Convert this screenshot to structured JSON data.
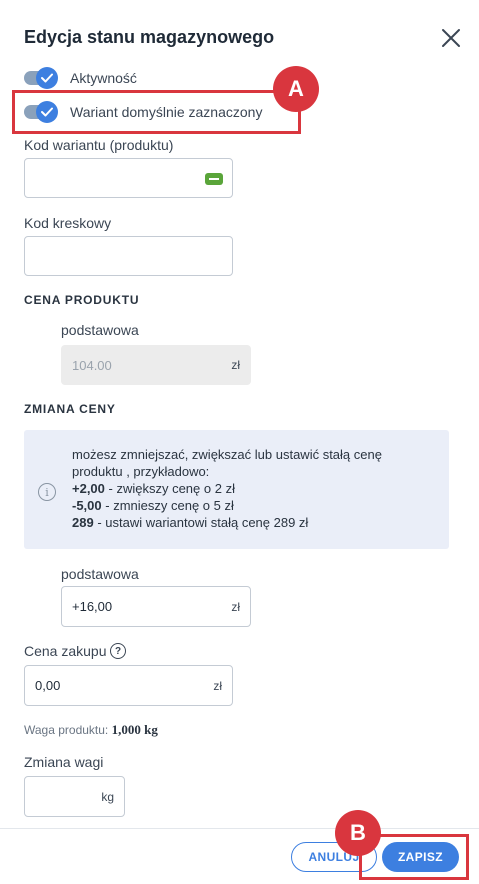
{
  "dialog": {
    "title": "Edycja stanu magazynowego"
  },
  "toggles": {
    "active_label": "Aktywność",
    "default_variant_label": "Wariant domyślnie zaznaczony"
  },
  "fields": {
    "variant_code_label": "Kod wariantu (produktu)",
    "variant_code_value": "",
    "barcode_label": "Kod kreskowy",
    "barcode_value": ""
  },
  "price_section": {
    "heading": "CENA PRODUKTU",
    "base_label": "podstawowa",
    "base_value": "104.00",
    "currency": "zł"
  },
  "price_change": {
    "heading": "ZMIANA CENY",
    "info_intro": "możesz zmniejszać, zwiększać lub ustawić stałą cenę produktu , przykładowo:",
    "ex1_bold": "+2,00",
    "ex1_text": " - zwiększy cenę o 2 zł",
    "ex2_bold": "-5,00",
    "ex2_text": " - zmnieszy cenę o 5 zł",
    "ex3_bold": "289",
    "ex3_text": " - ustawi wariantowi stałą cenę 289 zł",
    "base_label": "podstawowa",
    "base_value": "+16,00",
    "currency": "zł"
  },
  "purchase": {
    "label": "Cena zakupu",
    "help": "?",
    "value": "0,00",
    "currency": "zł"
  },
  "weight": {
    "info_label": "Waga produktu: ",
    "info_value": "1,000 kg",
    "change_label": "Zmiana wagi",
    "value": "",
    "unit": "kg"
  },
  "buttons": {
    "cancel": "ANULUJ",
    "save": "ZAPISZ"
  },
  "annotations": {
    "marker_a": "A",
    "marker_b": "B",
    "color": "#d9363e"
  },
  "colors": {
    "accent": "#3d7fe0",
    "info_bg": "#eaeef8"
  }
}
